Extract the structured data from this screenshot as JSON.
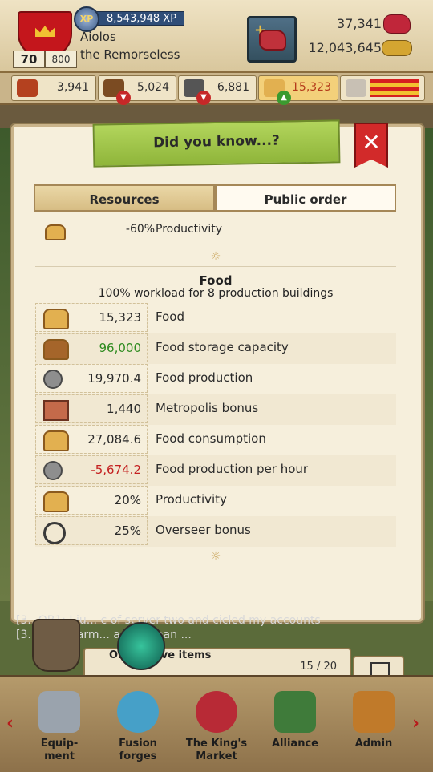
{
  "header": {
    "xp": "8,543,948 XP",
    "xp_badge": "XP",
    "player_name": "Aiolos",
    "player_title": "the Remorseless",
    "level": "70",
    "level_max": "800",
    "rubies": "37,341",
    "gold": "12,043,645"
  },
  "resources": [
    {
      "name": "units",
      "value": "3,941",
      "badge": ""
    },
    {
      "name": "wood",
      "value": "5,024",
      "badge": "▼"
    },
    {
      "name": "stone",
      "value": "6,881",
      "badge": "▼"
    },
    {
      "name": "food",
      "value": "15,323",
      "badge": "▲"
    }
  ],
  "modal": {
    "title": "Did you know...?",
    "close_symbol": "✕",
    "tabs": [
      {
        "label": "Resources",
        "active": true
      },
      {
        "label": "Public order",
        "active": false
      }
    ],
    "partial_row": {
      "value": "-60%",
      "label": "Productivity"
    },
    "ornament": "☼",
    "section_title": "Food",
    "section_subtitle": "100% workload for 8 production buildings",
    "rows": [
      {
        "icon": "bread-icon",
        "value": "15,323",
        "label": "Food",
        "tone": "normal"
      },
      {
        "icon": "storage-icon",
        "value": "96,000",
        "label": "Food storage capacity",
        "tone": "positive"
      },
      {
        "icon": "gear-bread-icon",
        "value": "19,970.4",
        "label": "Food production",
        "tone": "normal"
      },
      {
        "icon": "metropolis-icon",
        "value": "1,440",
        "label": "Metropolis bonus",
        "tone": "normal"
      },
      {
        "icon": "consumption-icon",
        "value": "27,084.6",
        "label": "Food consumption",
        "tone": "normal"
      },
      {
        "icon": "production-hour-icon",
        "value": "-5,674.2",
        "label": "Food production per hour",
        "tone": "negative"
      },
      {
        "icon": "productivity-icon",
        "value": "20%",
        "label": "Productivity",
        "tone": "normal"
      },
      {
        "icon": "whip-icon",
        "value": "25%",
        "label": "Overseer bonus",
        "tone": "normal"
      }
    ]
  },
  "chat": {
    "line1": "[3...OB1: I ju... c of server two and cicled my accounts",
    "line2": "[3... OB1: farm... a mad man ..."
  },
  "coop": {
    "label": "O... erative items",
    "count": "15 / 20"
  },
  "nav": [
    {
      "label": "Equip-\nment"
    },
    {
      "label": "Fusion\nforges"
    },
    {
      "label": "The King's\nMarket"
    },
    {
      "label": "Alliance"
    },
    {
      "label": "Admin"
    }
  ],
  "colors": {
    "positive": "#2e8b1f",
    "negative": "#c42020",
    "title_green": "#9fc64a",
    "close_red": "#d22a2a"
  }
}
